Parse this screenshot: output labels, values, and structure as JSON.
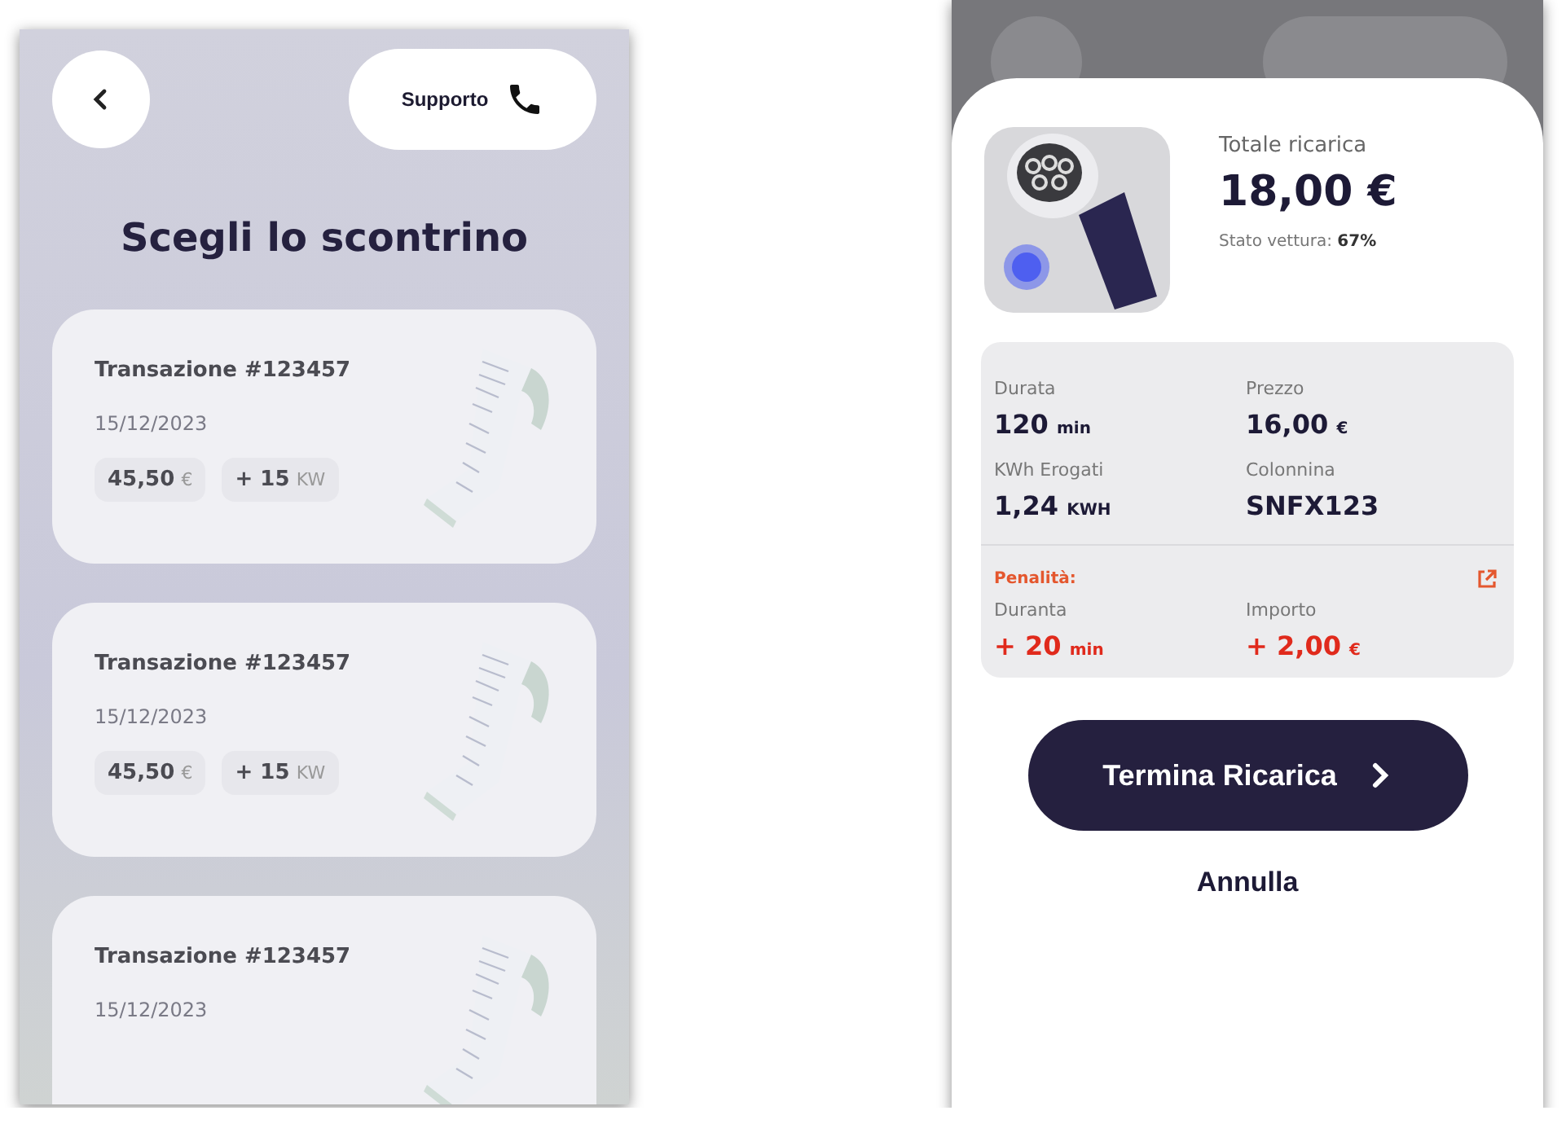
{
  "receipt_screen": {
    "support_button": {
      "label": "Supporto"
    },
    "title": "Scegli lo scontrino",
    "receipts": [
      {
        "title": "Transazione #123457",
        "date": "15/12/2023",
        "chips": [
          {
            "value": "45,50",
            "unit": "€"
          },
          {
            "value": "+ 15",
            "unit": "KW"
          }
        ]
      },
      {
        "title": "Transazione #123457",
        "date": "15/12/2023",
        "chips": [
          {
            "value": "45,50",
            "unit": "€"
          },
          {
            "value": "+ 15",
            "unit": "KW"
          }
        ]
      },
      {
        "title": "Transazione #123457",
        "date": "15/12/2023"
      }
    ]
  },
  "charge_sheet": {
    "summary": {
      "label": "Totale ricarica",
      "amount": "18,00 €",
      "status_label": "Stato vettura:",
      "status_value": "67%"
    },
    "details": [
      {
        "label": "Durata",
        "value": "120",
        "unit": "min"
      },
      {
        "label": "Prezzo",
        "value": "16,00",
        "unit": "€"
      },
      {
        "label": "KWh Erogati",
        "value": "1,24",
        "unit": "KWH"
      },
      {
        "label": "Colonnina",
        "value": "SNFX123"
      }
    ],
    "penalty": {
      "title": "Penalità:",
      "items": [
        {
          "label": "Duranta",
          "value": "+ 20",
          "unit": "min"
        },
        {
          "label": "Importo",
          "value": "+ 2,00",
          "unit": "€"
        }
      ]
    },
    "primary_button": {
      "label": "Termina Ricarica"
    },
    "cancel_button": {
      "label": "Annulla"
    }
  }
}
